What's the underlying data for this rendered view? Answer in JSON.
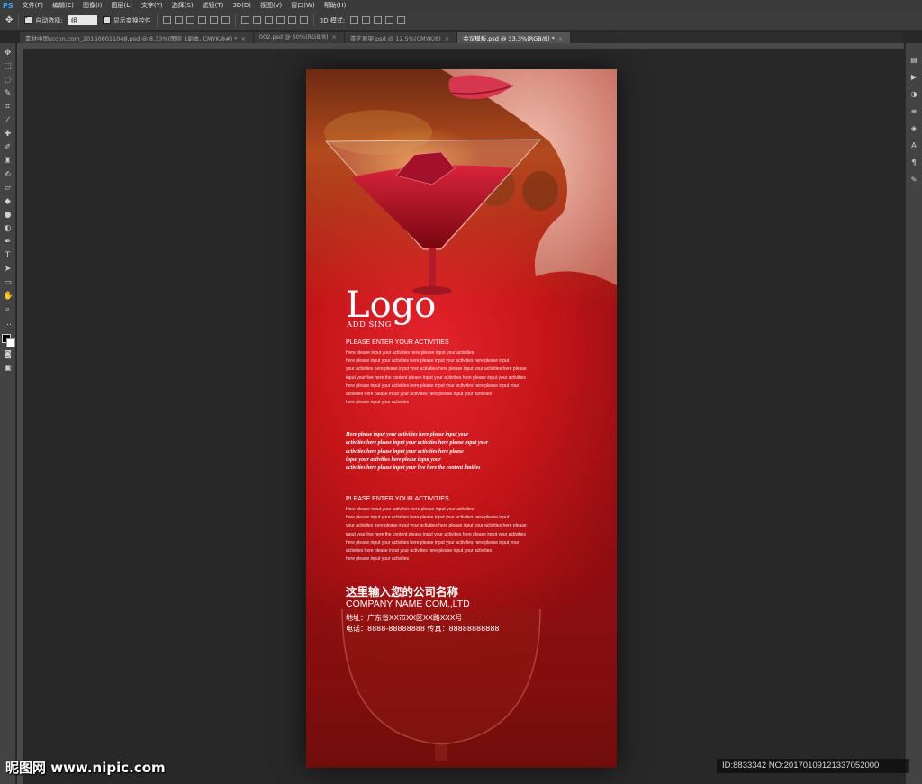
{
  "app": {
    "logo": "PS"
  },
  "menu": [
    "文件(F)",
    "编辑(E)",
    "图像(I)",
    "图层(L)",
    "文字(Y)",
    "选择(S)",
    "滤镜(T)",
    "3D(D)",
    "视图(V)",
    "窗口(W)",
    "帮助(H)"
  ],
  "options": {
    "auto_select_label": "自动选择:",
    "auto_select_value": "组",
    "show_transform_label": "显示变换控件",
    "mode_3d_label": "3D 模式:"
  },
  "tabs": [
    {
      "label": "素材中国sccnn.com_2016080110​48.psd @ 8.33%(图层 1副本, CMYK/8#) *"
    },
    {
      "label": "002.psd @ 50%(RGB/8)"
    },
    {
      "label": "茶艺展架.psd @ 12.5%(CMYK/8)"
    },
    {
      "label": "会议模板.psd @ 33.3%(RGB/8) *"
    }
  ],
  "document": {
    "logo_text": "Logo",
    "logo_sub": "ADD SING",
    "section1": {
      "heading": "PLEASE ENTER YOUR ACTIVITIES",
      "lines": [
        "Here please input your activities here please input your activities",
        "here please input your activities here please input your activities here please input",
        "your activities here please input your activities here please input your activities here please",
        "input your live here the content please input your activities here please input your activities",
        "here please input your activities here please input your activities here please input your",
        " activities here please input your activities here please input your activities",
        "here please input your activities"
      ]
    },
    "italic_block": [
      "Here please input your activities here please input your",
      "activities here please input your activities here please input your",
      "activities here please input your activities here please",
      "input your activities here please input your",
      "activities here please input your live here the content limities"
    ],
    "section2": {
      "heading": "PLEASE ENTER YOUR ACTIVITIES",
      "lines": [
        "Here please input your activities here please input your activities",
        "here please input your activities here please input your activities here please input",
        "your activities here please input your activities here please input your activities here please",
        "input your live here the content please input your activities here please input your activities",
        "here please input your activities here please input your activities here please input your",
        " activities here please input your activities here please input your activities",
        "here please input your activities"
      ]
    },
    "company_cn": "这里输入您的公司名称",
    "company_en": "COMPANY NAME COM.,LTD",
    "address": "地址：广东省XX市XX区XX路XXX号",
    "phone": "电话：8888-88888888  传真：88888888888"
  },
  "watermark": "昵图网 www.nipic.com",
  "image_id": "ID:8833342 NO:20170109121337052000",
  "colors": {
    "accent": "#39a8ff",
    "poster_red": "#c51519"
  }
}
